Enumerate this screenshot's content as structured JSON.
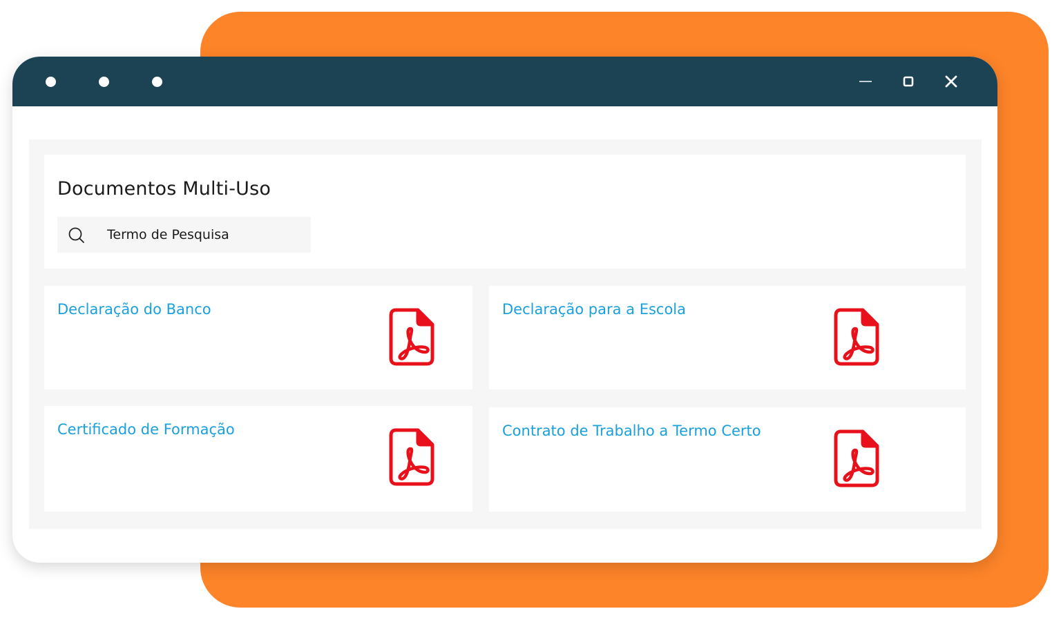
{
  "colors": {
    "accent_orange": "#fd8429",
    "titlebar": "#1c4354",
    "link_blue": "#1aa0dc",
    "pdf_red": "#e8101a"
  },
  "page": {
    "title": "Documentos Multi-Uso",
    "search": {
      "placeholder": "Termo de Pesquisa",
      "value": ""
    }
  },
  "documents": [
    {
      "title": "Declaração do Banco",
      "icon": "pdf-icon"
    },
    {
      "title": "Declaração para a Escola",
      "icon": "pdf-icon"
    },
    {
      "title": "Certificado de Formação",
      "icon": "pdf-icon"
    },
    {
      "title": "Contrato de Trabalho a Termo Certo",
      "icon": "pdf-icon"
    }
  ],
  "window_controls": [
    "minimize-icon",
    "maximize-icon",
    "close-icon"
  ]
}
